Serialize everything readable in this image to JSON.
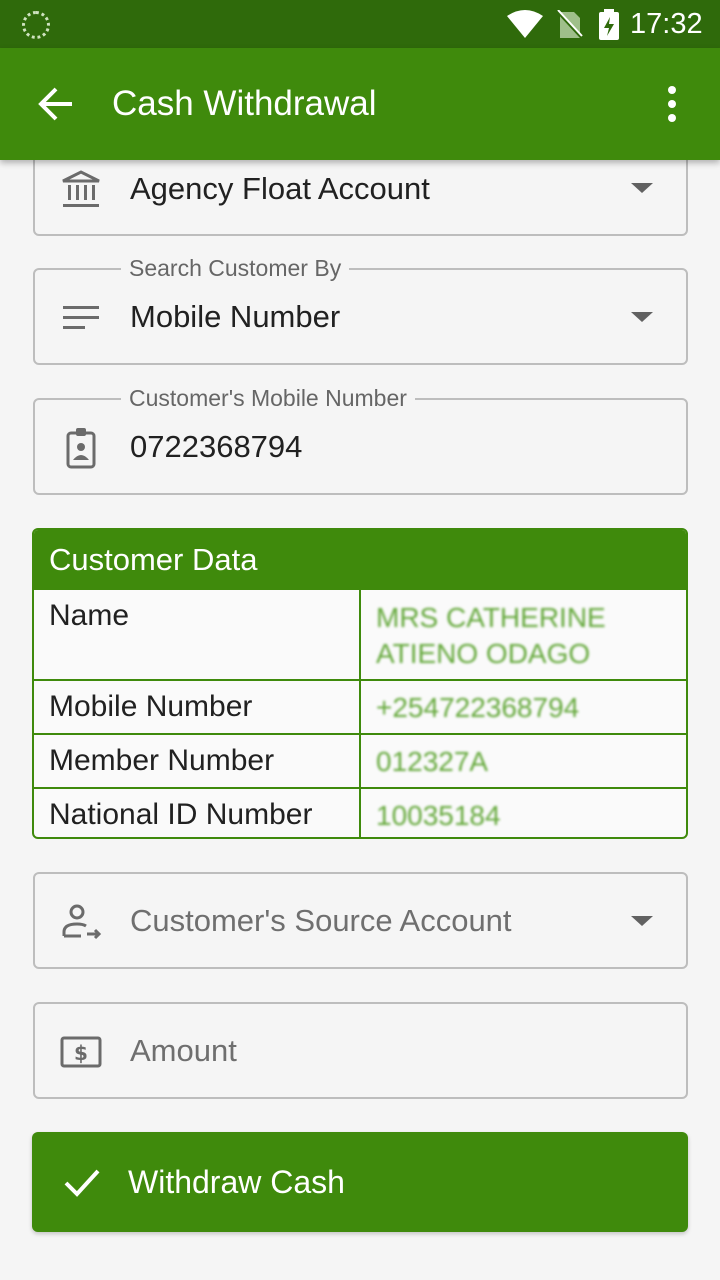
{
  "status_bar": {
    "time": "17:32",
    "icons": [
      "notification-icon",
      "wifi-icon",
      "no-sim-icon",
      "battery-charging-icon"
    ]
  },
  "app_bar": {
    "title": "Cash Withdrawal",
    "back_icon": "arrow-back-icon",
    "overflow_icon": "more-vert-icon"
  },
  "form": {
    "agency_account": {
      "value": "Agency Float Account",
      "icon": "bank-icon"
    },
    "search_by": {
      "label": "Search Customer By",
      "value": "Mobile Number",
      "icon": "sort-lines-icon"
    },
    "mobile_number": {
      "label": "Customer's Mobile Number",
      "value": "0722368794",
      "icon": "id-badge-icon"
    },
    "source_account": {
      "placeholder": "Customer's Source Account",
      "icon": "person-transfer-icon"
    },
    "amount": {
      "placeholder": "Amount",
      "icon": "money-icon"
    }
  },
  "customer_data": {
    "title": "Customer Data",
    "rows": [
      {
        "label": "Name",
        "value_line1": "MRS CATHERINE",
        "value_line2": "ATIENO ODAGO"
      },
      {
        "label": "Mobile Number",
        "value": "+254722368794"
      },
      {
        "label": "Member Number",
        "value": "012327A"
      },
      {
        "label": "National ID Number",
        "value": "10035184"
      }
    ]
  },
  "actions": {
    "withdraw_label": "Withdraw Cash",
    "withdraw_icon": "check-icon"
  },
  "colors": {
    "status_bar": "#2f6a0b",
    "app_bar": "#3f8a0c",
    "accent": "#3f8a0c",
    "value_text": "#4a9a1a"
  }
}
